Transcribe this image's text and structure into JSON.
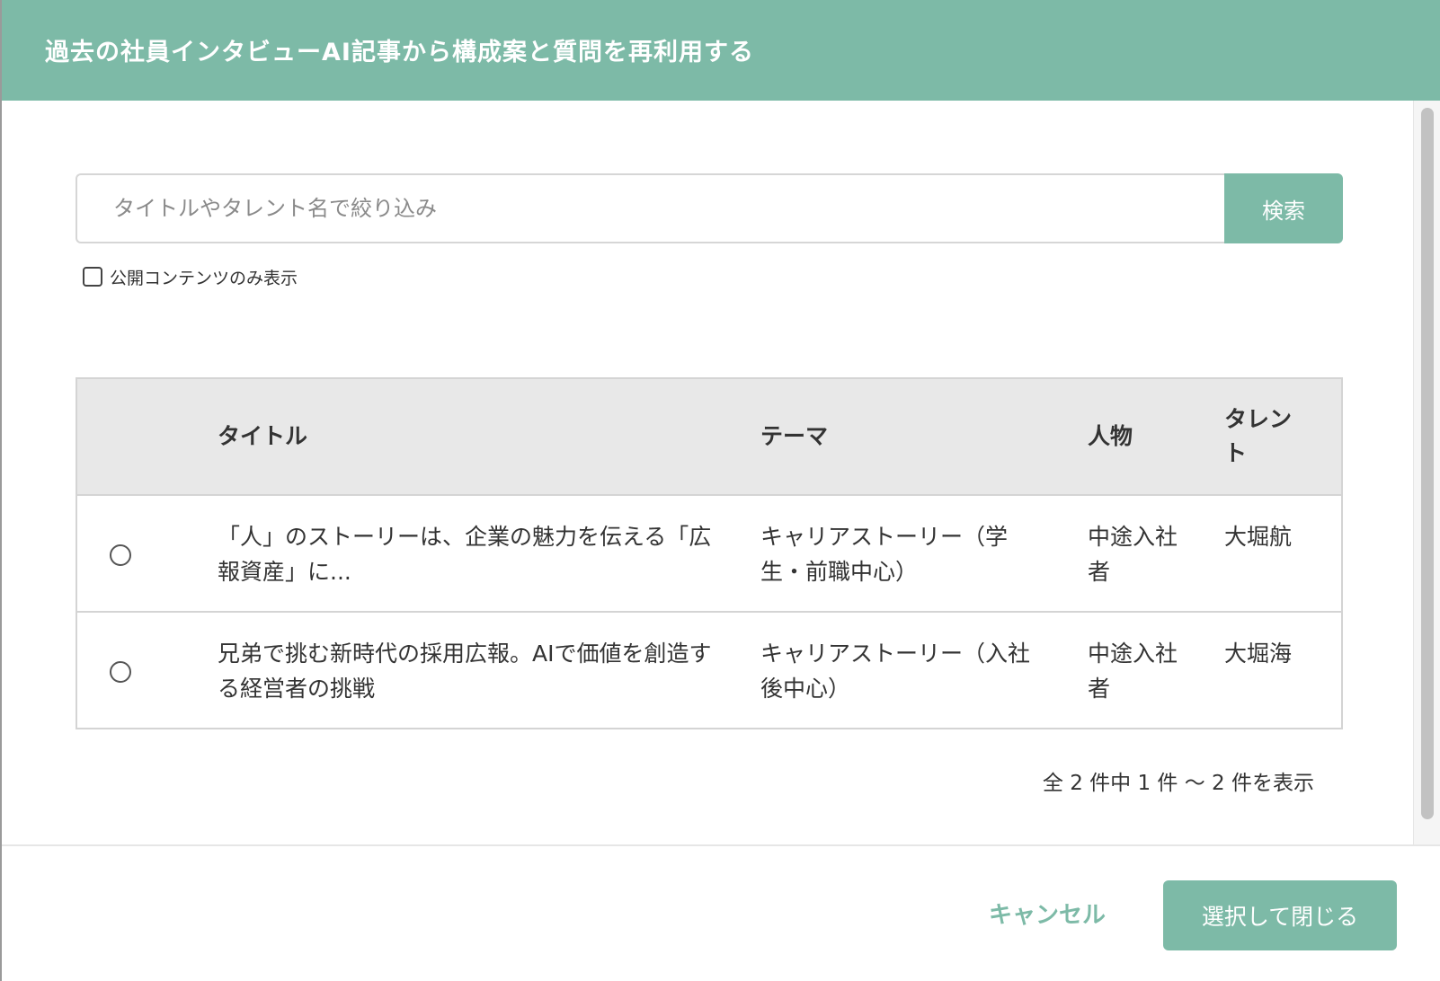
{
  "modal": {
    "title": "過去の社員インタビューAI記事から構成案と質問を再利用する"
  },
  "search": {
    "placeholder": "タイトルやタレント名で絞り込み",
    "value": "",
    "button_label": "検索"
  },
  "filter": {
    "public_only_label": "公開コンテンツのみ表示",
    "public_only_checked": false
  },
  "table": {
    "headers": {
      "title": "タイトル",
      "theme": "テーマ",
      "person": "人物",
      "talent": "タレント"
    },
    "rows": [
      {
        "selected": false,
        "title": "「人」のストーリーは、企業の魅力を伝える「広報資産」に...",
        "theme": "キャリアストーリー（学生・前職中心）",
        "person": "中途入社者",
        "talent": "大堀航"
      },
      {
        "selected": false,
        "title": "兄弟で挑む新時代の採用広報。AIで価値を創造する経営者の挑戦",
        "theme": "キャリアストーリー（入社後中心）",
        "person": "中途入社者",
        "talent": "大堀海"
      }
    ]
  },
  "pagination": {
    "summary": "全 2 件中 1 件 〜 2 件を表示"
  },
  "footer": {
    "cancel_label": "キャンセル",
    "confirm_label": "選択して閉じる"
  },
  "colors": {
    "accent": "#7dbaa7",
    "header_bg": "#e8e8e8",
    "border": "#d4d4d4"
  }
}
